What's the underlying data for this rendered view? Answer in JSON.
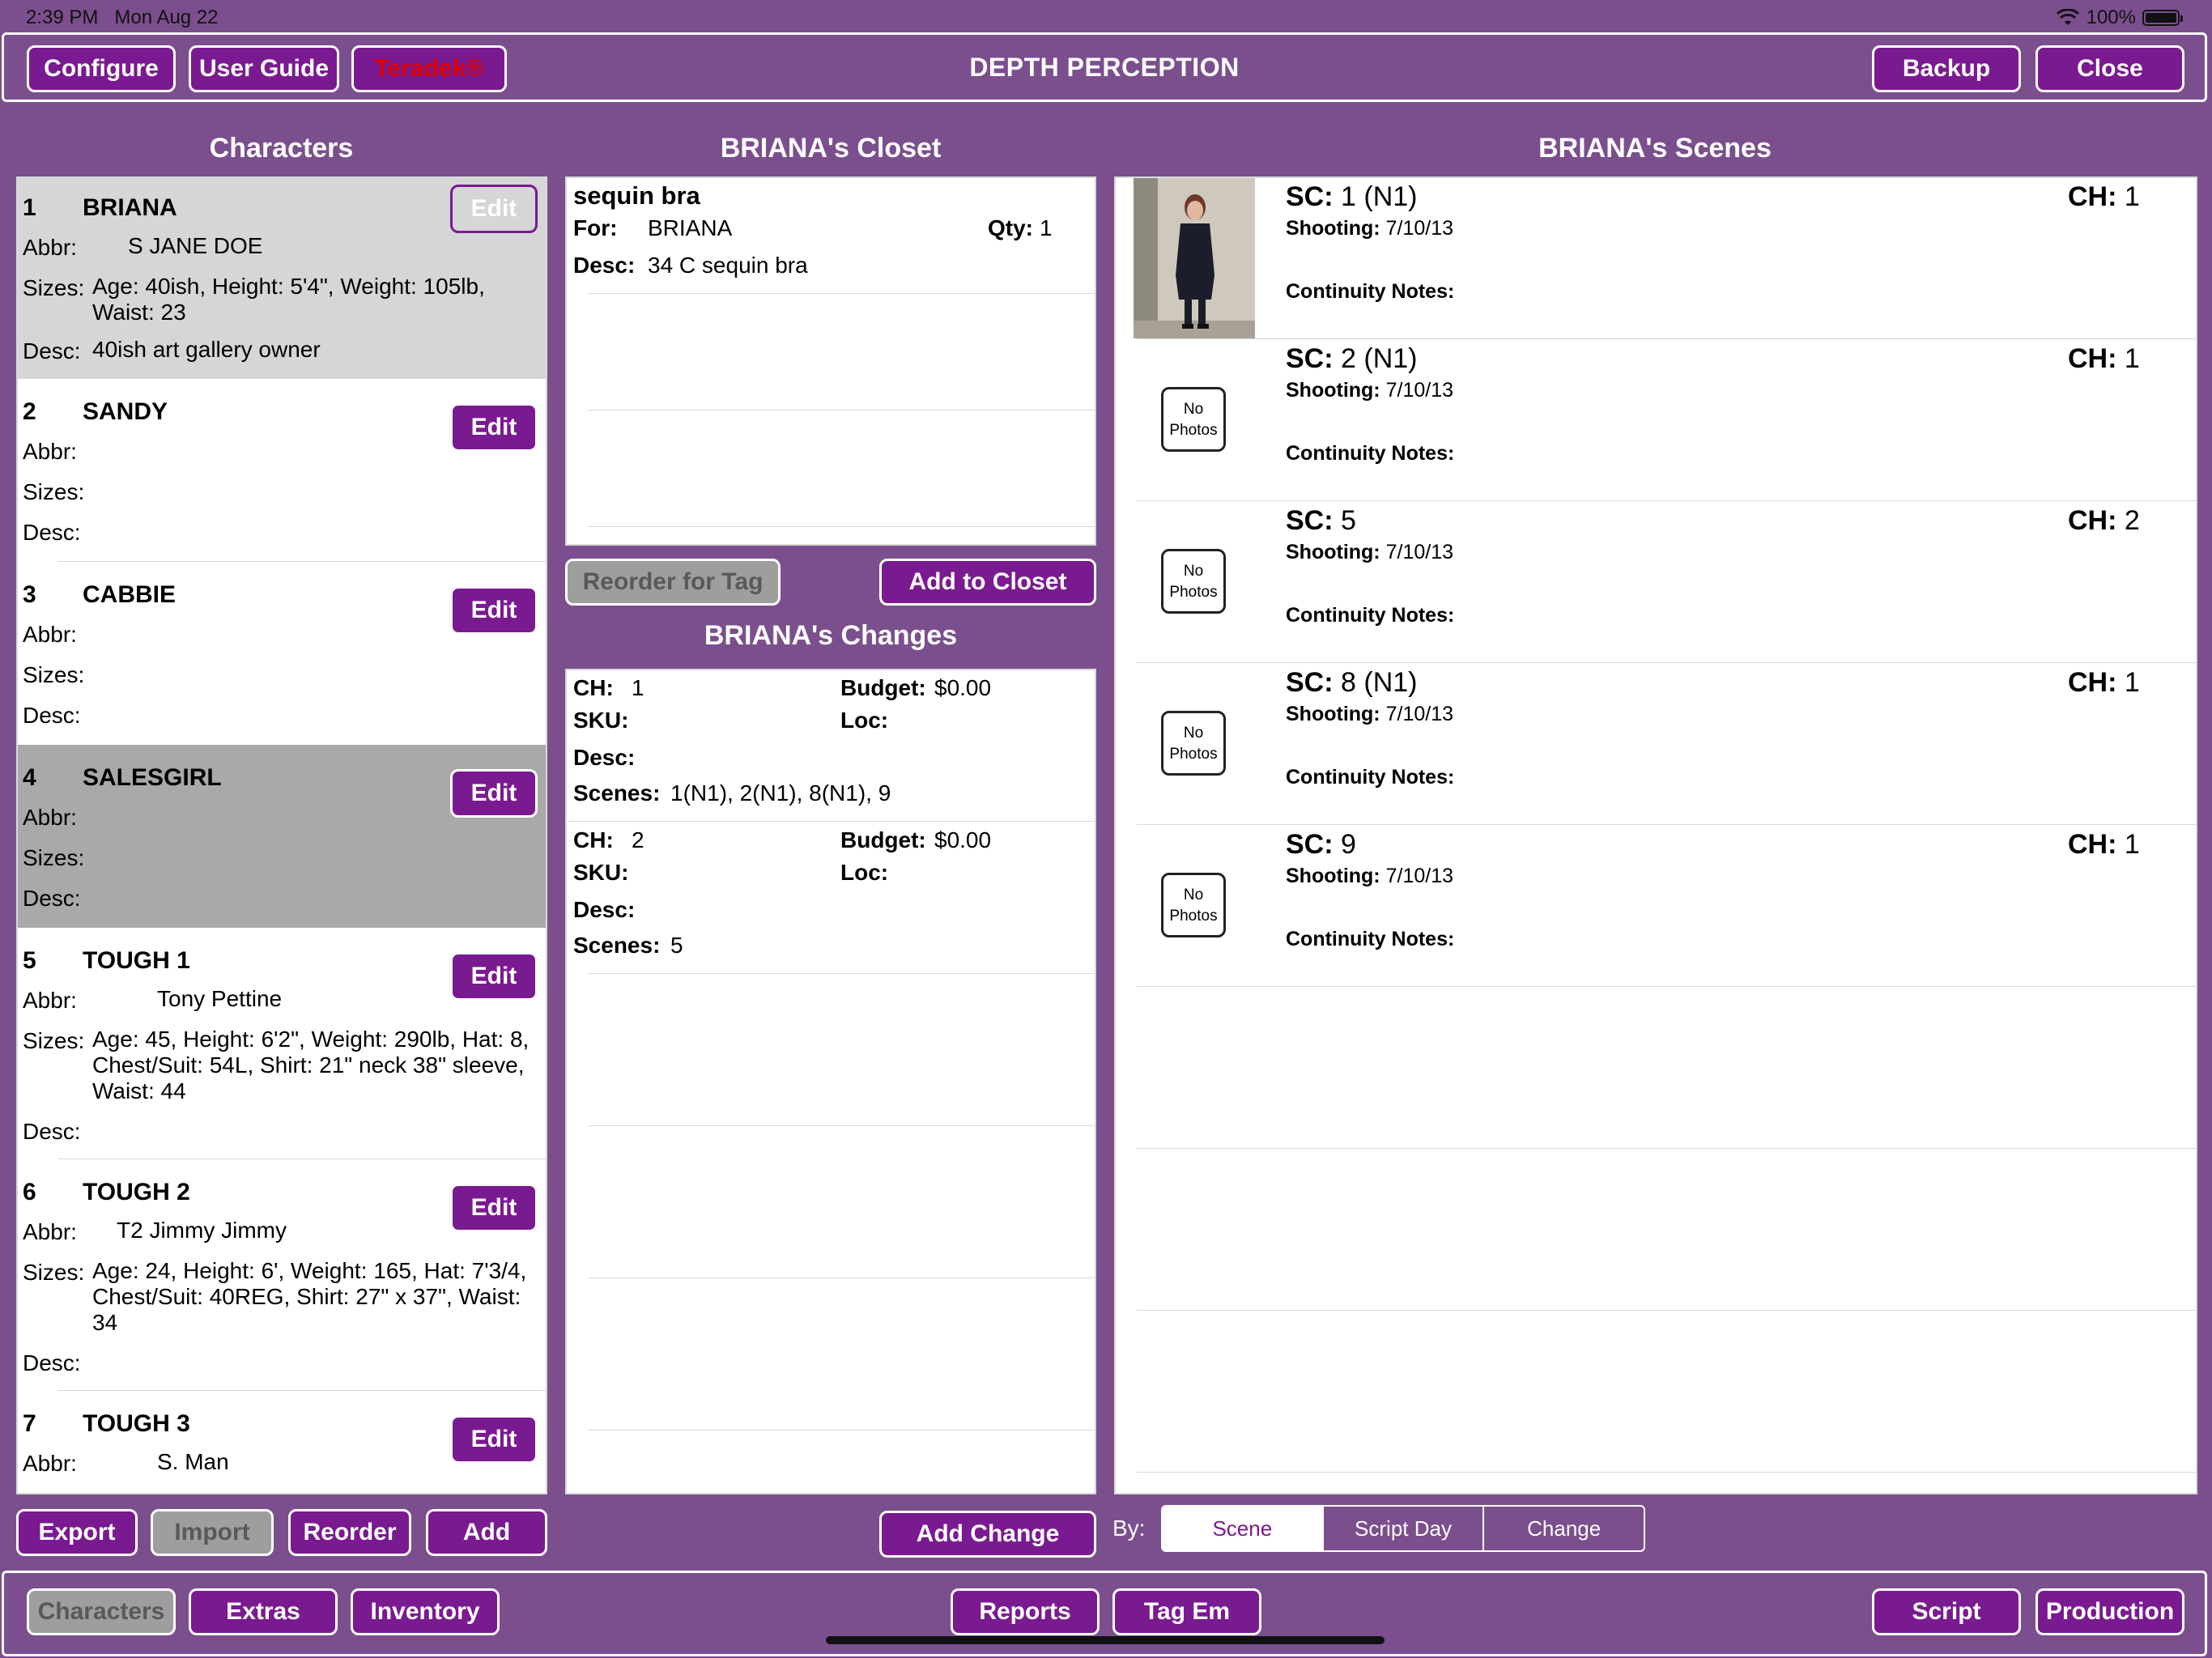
{
  "status": {
    "time": "2:39 PM",
    "date": "Mon Aug 22",
    "battery": "100%",
    "battery_level": 1.0
  },
  "header": {
    "title": "DEPTH PERCEPTION",
    "configure": "Configure",
    "user_guide": "User Guide",
    "teradek": "Teradek®",
    "backup": "Backup",
    "close": "Close"
  },
  "characters": {
    "title": "Characters",
    "labels": {
      "abbr": "Abbr:",
      "sizes": "Sizes:",
      "desc": "Desc:",
      "edit": "Edit"
    },
    "items": [
      {
        "num": "1",
        "name": "BRIANA",
        "abbr": "S  JANE DOE",
        "sizes": "Age: 40ish, Height: 5'4\", Weight: 105lb, Waist: 23",
        "desc": "40ish art gallery owner"
      },
      {
        "num": "2",
        "name": "SANDY",
        "abbr": "",
        "sizes": "",
        "desc": ""
      },
      {
        "num": "3",
        "name": "CABBIE",
        "abbr": "",
        "sizes": "",
        "desc": ""
      },
      {
        "num": "4",
        "name": "SALESGIRL",
        "abbr": "",
        "sizes": "",
        "desc": ""
      },
      {
        "num": "5",
        "name": "TOUGH 1",
        "abbr": "Tony Pettine",
        "sizes": "Age: 45, Height: 6'2\", Weight: 290lb, Hat: 8, Chest/Suit: 54L, Shirt: 21\" neck 38\" sleeve, Waist: 44",
        "desc": ""
      },
      {
        "num": "6",
        "name": "TOUGH 2",
        "abbr": "T2  Jimmy Jimmy",
        "sizes": "Age: 24, Height: 6', Weight: 165, Hat: 7'3/4, Chest/Suit: 40REG, Shirt: 27\" x 37\", Waist: 34",
        "desc": ""
      },
      {
        "num": "7",
        "name": "TOUGH 3",
        "abbr": "S. Man",
        "sizes": "",
        "desc": ""
      }
    ],
    "buttons": {
      "export": "Export",
      "import": "Import",
      "reorder": "Reorder",
      "add": "Add"
    }
  },
  "closet": {
    "title": "BRIANA's Closet",
    "item_name": "sequin bra",
    "for_label": "For:",
    "for_value": "BRIANA",
    "qty_label": "Qty:",
    "qty_value": "1",
    "desc_label": "Desc:",
    "desc_value": "34 C sequin bra",
    "reorder_for_tag": "Reorder for Tag",
    "add_to_closet": "Add to Closet"
  },
  "changes": {
    "title": "BRIANA's Changes",
    "labels": {
      "ch": "CH:",
      "budget": "Budget:",
      "sku": "SKU:",
      "loc": "Loc:",
      "desc": "Desc:",
      "scenes": "Scenes:"
    },
    "items": [
      {
        "ch": "1",
        "budget": "$0.00",
        "scenes": "1(N1), 2(N1), 8(N1), 9"
      },
      {
        "ch": "2",
        "budget": "$0.00",
        "scenes": "5"
      }
    ],
    "add_change": "Add Change"
  },
  "scenes": {
    "title": "BRIANA's Scenes",
    "labels": {
      "sc": "SC:",
      "ch": "CH:",
      "shooting": "Shooting:",
      "notes": "Continuity Notes:",
      "no_photos_1": "No",
      "no_photos_2": "Photos"
    },
    "items": [
      {
        "sc": "1 (N1)",
        "ch": "1",
        "shooting": "7/10/13"
      },
      {
        "sc": "2 (N1)",
        "ch": "1",
        "shooting": "7/10/13"
      },
      {
        "sc": "5",
        "ch": "2",
        "shooting": "7/10/13"
      },
      {
        "sc": "8 (N1)",
        "ch": "1",
        "shooting": "7/10/13"
      },
      {
        "sc": "9",
        "ch": "1",
        "shooting": "7/10/13"
      }
    ],
    "by_label": "By:",
    "segments": [
      "Scene",
      "Script Day",
      "Change"
    ],
    "selected_segment": "Scene"
  },
  "bottom_nav": {
    "characters": "Characters",
    "extras": "Extras",
    "inventory": "Inventory",
    "reports": "Reports",
    "tag_em": "Tag Em",
    "script": "Script",
    "production": "Production"
  },
  "colors": {
    "background": "#7b4f8e",
    "button": "#7a1a90",
    "teradek_text": "#e00000",
    "selected_row": "#d6d6d6",
    "highlight_row": "#a9a9a9"
  }
}
